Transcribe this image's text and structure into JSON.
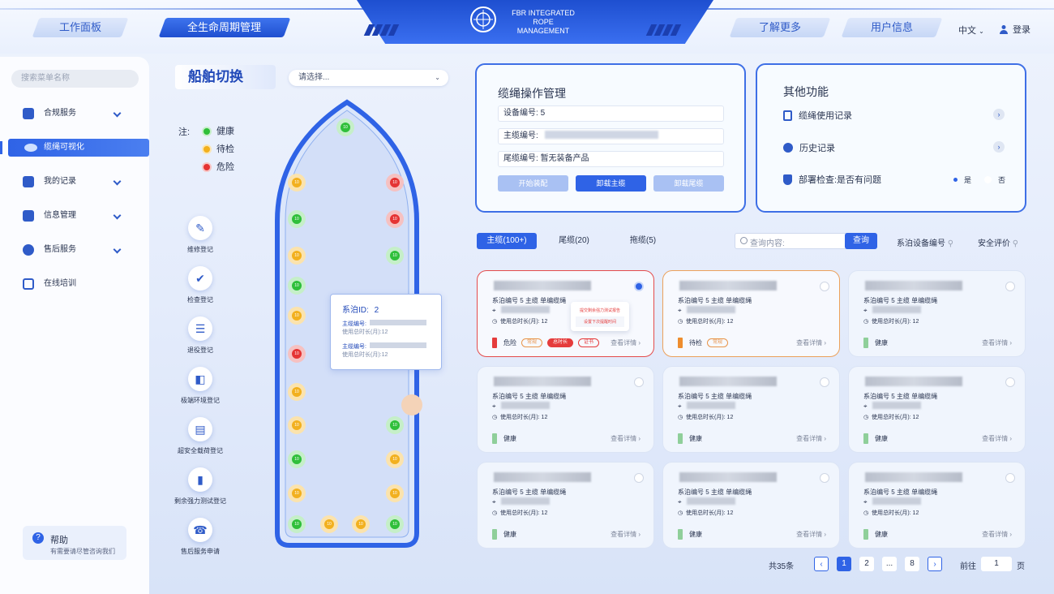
{
  "header": {
    "nav_left": [
      "工作面板",
      "全生命周期管理"
    ],
    "brand_line1": "FBR INTEGRATED ROPE",
    "brand_line2": "MANAGEMENT",
    "nav_right": [
      "了解更多",
      "用户信息"
    ],
    "language": "中文",
    "login": "登录"
  },
  "sidebar": {
    "search_placeholder": "搜索菜单名称",
    "items": [
      {
        "label": "合规服务",
        "icon": "compliance-icon",
        "expandable": true
      },
      {
        "label": "缆绳可视化",
        "icon": "rope-visual-icon",
        "active": true
      },
      {
        "label": "我的记录",
        "icon": "record-icon",
        "expandable": true
      },
      {
        "label": "信息管理",
        "icon": "building-icon",
        "expandable": true
      },
      {
        "label": "售后服务",
        "icon": "service-icon",
        "expandable": true
      },
      {
        "label": "在线培训",
        "icon": "monitor-icon"
      }
    ],
    "help": {
      "title": "帮助",
      "subtitle": "有需要请尽管咨询我们"
    }
  },
  "ship": {
    "title": "船舶切换",
    "select_placeholder": "请选择...",
    "legend_label": "注:",
    "legend": [
      {
        "label": "健康",
        "color": "#2fbf3a"
      },
      {
        "label": "待检",
        "color": "#f2b01e"
      },
      {
        "label": "危险",
        "color": "#e53333"
      }
    ],
    "bollard_label": "10",
    "tools": [
      "维修登记",
      "检查登记",
      "退役登记",
      "极端环境登记",
      "超安全载荷登记",
      "剩余强力测试登记",
      "售后服务申请"
    ],
    "popup": {
      "id_label": "系泊ID:",
      "id_value": "2",
      "main_label": "主缆编号:",
      "used_label": "使用总时长(月):12"
    }
  },
  "rope_panel": {
    "title": "缆绳操作管理",
    "fields": [
      {
        "label": "设备编号:",
        "value": "5"
      },
      {
        "label": "主缆编号:",
        "value": ""
      },
      {
        "label": "尾缆编号:",
        "value": "暂无装备产品"
      }
    ],
    "buttons": [
      "开始装配",
      "卸载主缆",
      "卸载尾缆"
    ]
  },
  "other_panel": {
    "title": "其他功能",
    "items": [
      "缆绳使用记录",
      "历史记录"
    ],
    "deploy_check": "部署检查:是否有问题",
    "options": [
      "是",
      "否"
    ]
  },
  "tabs": [
    "主缆(100+)",
    "尾缆(20)",
    "拖缆(5)"
  ],
  "search": {
    "placeholder": "查询内容:",
    "button": "查询"
  },
  "filters": [
    "系泊设备编号",
    "安全评价"
  ],
  "card_text": {
    "line1": "系泊编号 5  主缆  单编缆绳",
    "used": "使用总时长(月):  12",
    "detail": "查看详情"
  },
  "cards": [
    {
      "status": "危险",
      "color": "#e53c3c",
      "selected": true,
      "tags": [
        "常规",
        "总时长",
        "证书"
      ]
    },
    {
      "status": "待检",
      "color": "#ee8d2e",
      "tags": [
        "常规"
      ]
    },
    {
      "status": "健康",
      "color": "#8fcf9a"
    },
    {
      "status": "健康",
      "color": "#8fcf9a"
    },
    {
      "status": "健康",
      "color": "#8fcf9a"
    },
    {
      "status": "健康",
      "color": "#8fcf9a"
    },
    {
      "status": "健康",
      "color": "#8fcf9a"
    },
    {
      "status": "健康",
      "color": "#8fcf9a"
    },
    {
      "status": "健康",
      "color": "#8fcf9a"
    }
  ],
  "context_menu": [
    "提交剩余强力测试报告",
    "设置下次提醒时间"
  ],
  "pagination": {
    "total": "共35条",
    "pages": [
      "1",
      "2",
      "...",
      "8"
    ],
    "goto_label": "前往",
    "goto_value": "1",
    "page_suffix": "页"
  }
}
